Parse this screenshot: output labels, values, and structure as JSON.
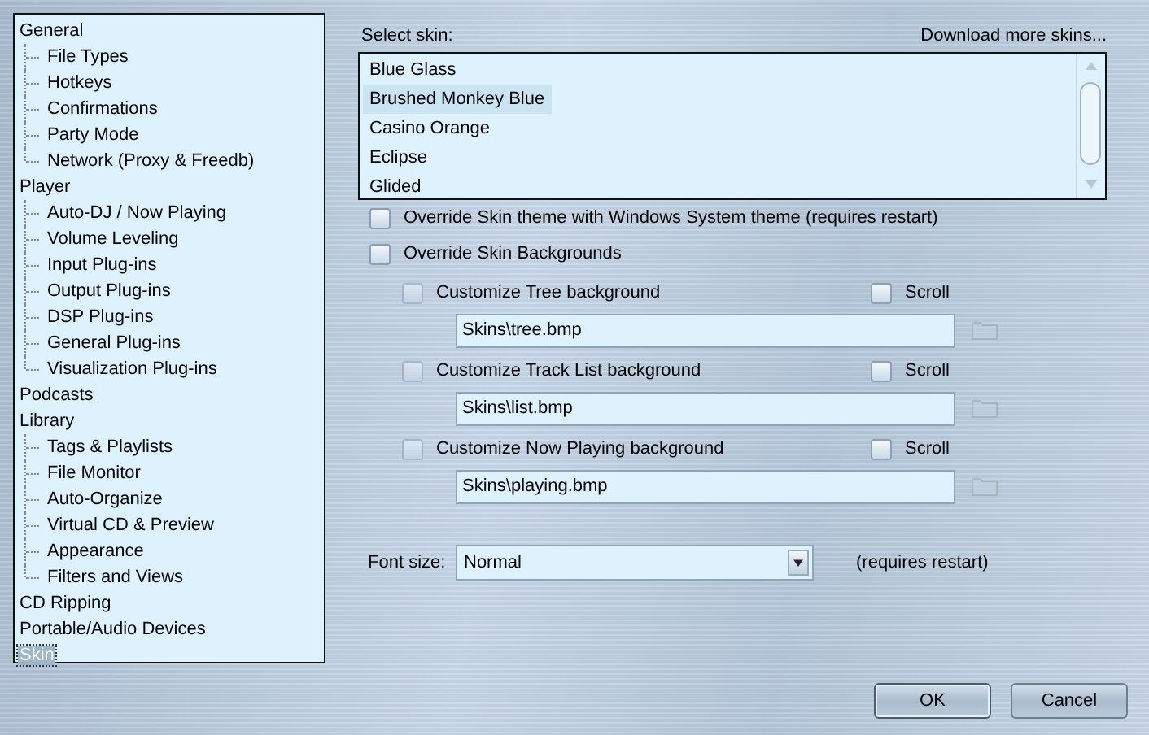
{
  "tree": [
    {
      "label": "General",
      "selected": false,
      "children": [
        {
          "label": "File Types",
          "selected": false
        },
        {
          "label": "Hotkeys",
          "selected": false
        },
        {
          "label": "Confirmations",
          "selected": false
        },
        {
          "label": "Party Mode",
          "selected": false
        },
        {
          "label": "Network (Proxy & Freedb)",
          "selected": false
        }
      ]
    },
    {
      "label": "Player",
      "selected": false,
      "children": [
        {
          "label": "Auto-DJ / Now Playing",
          "selected": false
        },
        {
          "label": "Volume Leveling",
          "selected": false
        },
        {
          "label": "Input Plug-ins",
          "selected": false
        },
        {
          "label": "Output Plug-ins",
          "selected": false
        },
        {
          "label": "DSP Plug-ins",
          "selected": false
        },
        {
          "label": "General Plug-ins",
          "selected": false
        },
        {
          "label": "Visualization Plug-ins",
          "selected": false
        }
      ]
    },
    {
      "label": "Podcasts",
      "selected": false
    },
    {
      "label": "Library",
      "selected": false,
      "children": [
        {
          "label": "Tags & Playlists",
          "selected": false
        },
        {
          "label": "File Monitor",
          "selected": false
        },
        {
          "label": "Auto-Organize",
          "selected": false
        },
        {
          "label": "Virtual CD & Preview",
          "selected": false
        },
        {
          "label": "Appearance",
          "selected": false
        },
        {
          "label": "Filters and Views",
          "selected": false
        }
      ]
    },
    {
      "label": "CD Ripping",
      "selected": false
    },
    {
      "label": "Portable/Audio Devices",
      "selected": false
    },
    {
      "label": "Skin",
      "selected": true
    }
  ],
  "skin_label": "Select skin:",
  "download_link": "Download more skins...",
  "skins": [
    {
      "label": "Blue Glass",
      "selected": false
    },
    {
      "label": "Brushed Monkey Blue",
      "selected": true
    },
    {
      "label": "Casino Orange",
      "selected": false
    },
    {
      "label": "Eclipse",
      "selected": false
    },
    {
      "label": "Glided",
      "selected": false
    }
  ],
  "override_options": [
    {
      "label": "Override Skin theme with Windows System theme (requires restart)",
      "checked": false
    },
    {
      "label": "Override Skin Backgrounds",
      "checked": false
    }
  ],
  "backgrounds": [
    {
      "label": "Customize Tree background",
      "checked": false,
      "disabled": true,
      "path": "Skins\\tree.bmp",
      "scroll": {
        "label": "Scroll",
        "checked": false
      }
    },
    {
      "label": "Customize Track List background",
      "checked": false,
      "disabled": true,
      "path": "Skins\\list.bmp",
      "scroll": {
        "label": "Scroll",
        "checked": false
      }
    },
    {
      "label": "Customize Now Playing background",
      "checked": false,
      "disabled": true,
      "path": "Skins\\playing.bmp",
      "scroll": {
        "label": "Scroll",
        "checked": false
      }
    }
  ],
  "font_size": {
    "label": "Font size:",
    "value": "Normal",
    "note": "(requires restart)"
  },
  "buttons": [
    {
      "label": "OK",
      "default": true
    },
    {
      "label": "Cancel",
      "default": false
    }
  ]
}
